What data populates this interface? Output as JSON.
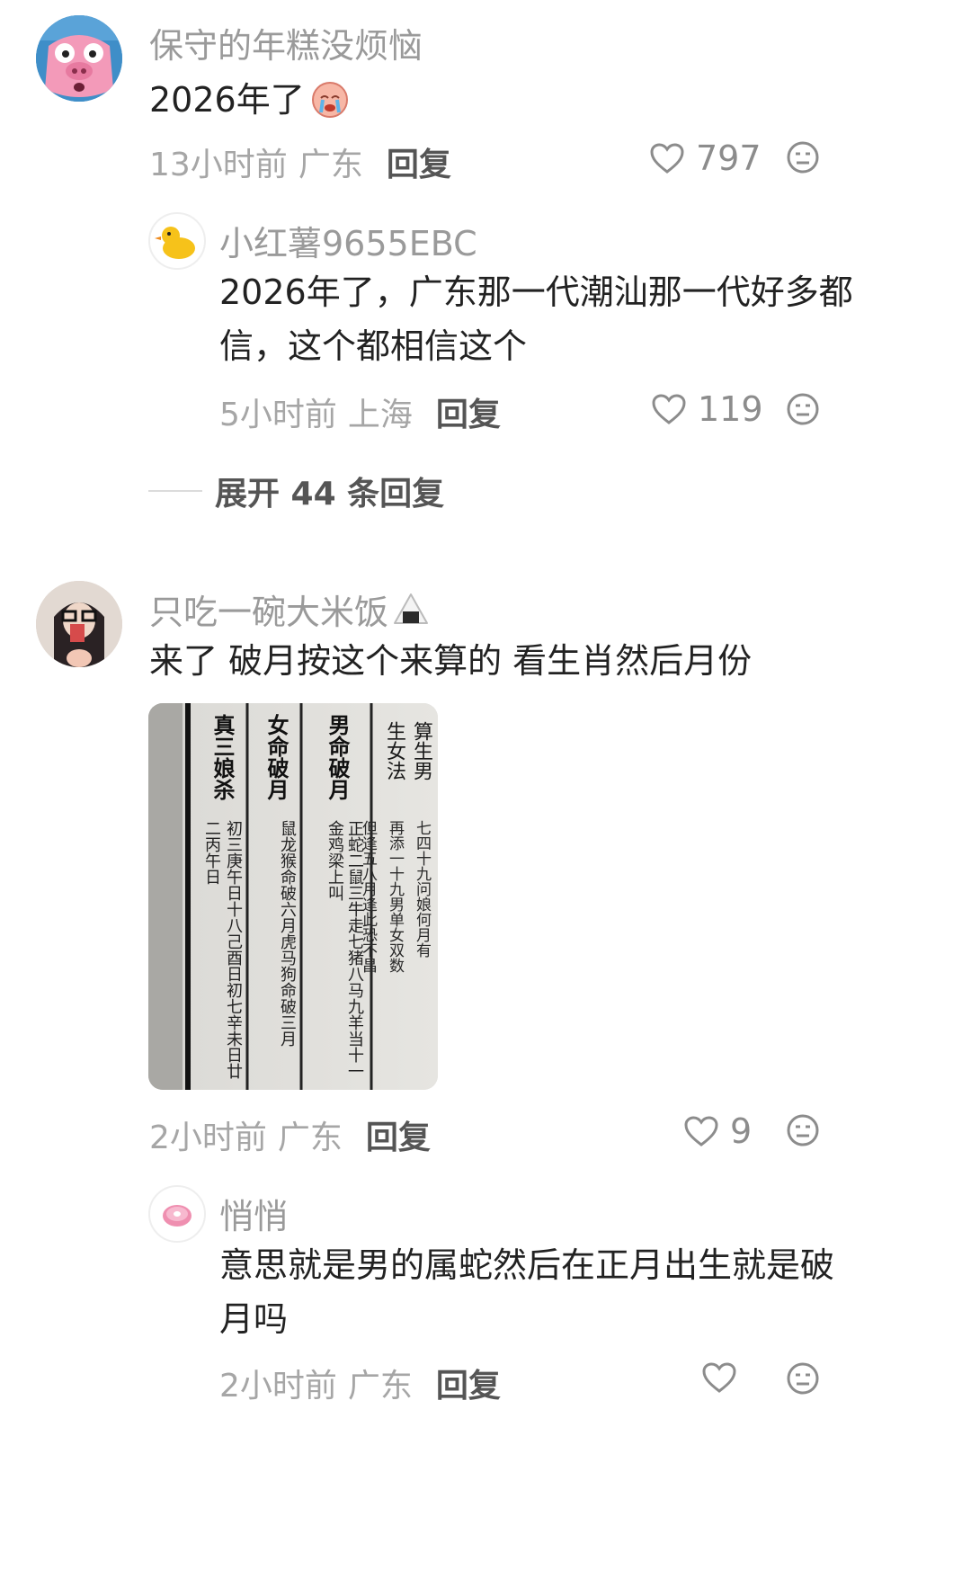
{
  "comments": [
    {
      "username": "保守的年糕没烦恼",
      "text": "2026年了",
      "time": "13小时前",
      "location": "广东",
      "reply_label": "回复",
      "likes": "797",
      "avatar_icon": "cartoon-pig-avatar",
      "inline_emoji": "crying-face-emoji",
      "replies": [
        {
          "username": "小红薯9655EBC",
          "text_line1": "2026年了，广东那一代潮汕那一代好多都",
          "text_line2": "信，这个都相信这个",
          "time": "5小时前",
          "location": "上海",
          "reply_label": "回复",
          "likes": "119",
          "avatar_icon": "yellow-duck-avatar"
        }
      ],
      "expand_label": "展开 44 条回复"
    },
    {
      "username": "只吃一碗大米饭",
      "username_emoji": "rice-ball-emoji",
      "text": "来了 破月按这个来算的 看生肖然后月份",
      "time": "2小时前",
      "location": "广东",
      "reply_label": "回复",
      "likes": "9",
      "avatar_icon": "girl-photo-avatar",
      "attached_image": {
        "columns": [
          {
            "title": "算生男",
            "body": "七四十九问娘何月有"
          },
          {
            "title": "生女法",
            "body": "再添一十九男单女双数"
          },
          {
            "title": "",
            "body": "但逢五八月逢此恐不昌"
          },
          {
            "title": "男命破月",
            "body": "正蛇二鼠三牛走七猪八马九羊当十一金鸡梁上叫"
          },
          {
            "title": "女命破月",
            "body": "鼠龙猴命破六月虎马狗命破三月"
          },
          {
            "title": "真三娘杀",
            "body": "初三庚午日十八己酉日初七辛未日廿二丙午日"
          }
        ]
      },
      "replies": [
        {
          "username": "悄悄",
          "text_line1": "意思就是男的属蛇然后在正月出生就是破",
          "text_line2": "月吗",
          "time": "2小时前",
          "location": "广东",
          "reply_label": "回复",
          "avatar_icon": "pink-donut-avatar"
        }
      ]
    }
  ],
  "colors": {
    "username": "#9a9a9a",
    "body_text": "#222222",
    "meta": "#a6a6a6",
    "reply": "#555555",
    "icon": "#8c8c8c"
  }
}
